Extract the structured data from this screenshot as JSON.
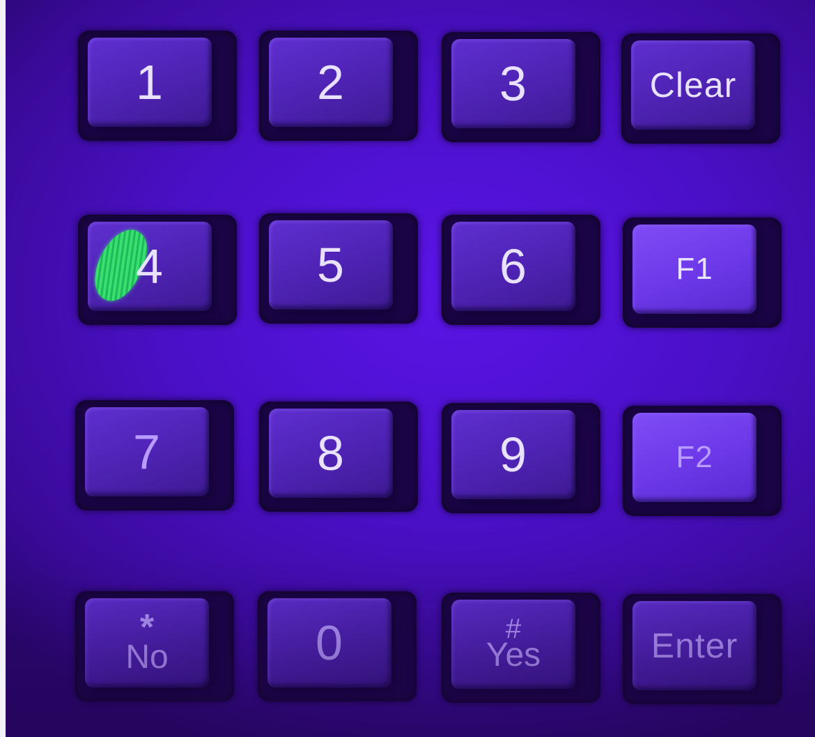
{
  "keypad": {
    "keys": [
      {
        "id": "1",
        "label": "1"
      },
      {
        "id": "2",
        "label": "2"
      },
      {
        "id": "3",
        "label": "3"
      },
      {
        "id": "clear",
        "label": "Clear"
      },
      {
        "id": "4",
        "label": "4"
      },
      {
        "id": "5",
        "label": "5"
      },
      {
        "id": "6",
        "label": "6"
      },
      {
        "id": "f1",
        "label": "F1"
      },
      {
        "id": "7",
        "label": "7"
      },
      {
        "id": "8",
        "label": "8"
      },
      {
        "id": "9",
        "label": "9"
      },
      {
        "id": "f2",
        "label": "F2"
      },
      {
        "id": "no",
        "symbol": "*",
        "label": "No"
      },
      {
        "id": "0",
        "label": "0"
      },
      {
        "id": "yes",
        "symbol": "#",
        "label": "Yes"
      },
      {
        "id": "enter",
        "label": "Enter"
      }
    ]
  },
  "colors": {
    "background": "#4a10c8",
    "key": "#4d22b2",
    "highlight_key": "#6c38e8",
    "label": "#e9e2ff",
    "fluorescent_smudge": "#38e070"
  }
}
